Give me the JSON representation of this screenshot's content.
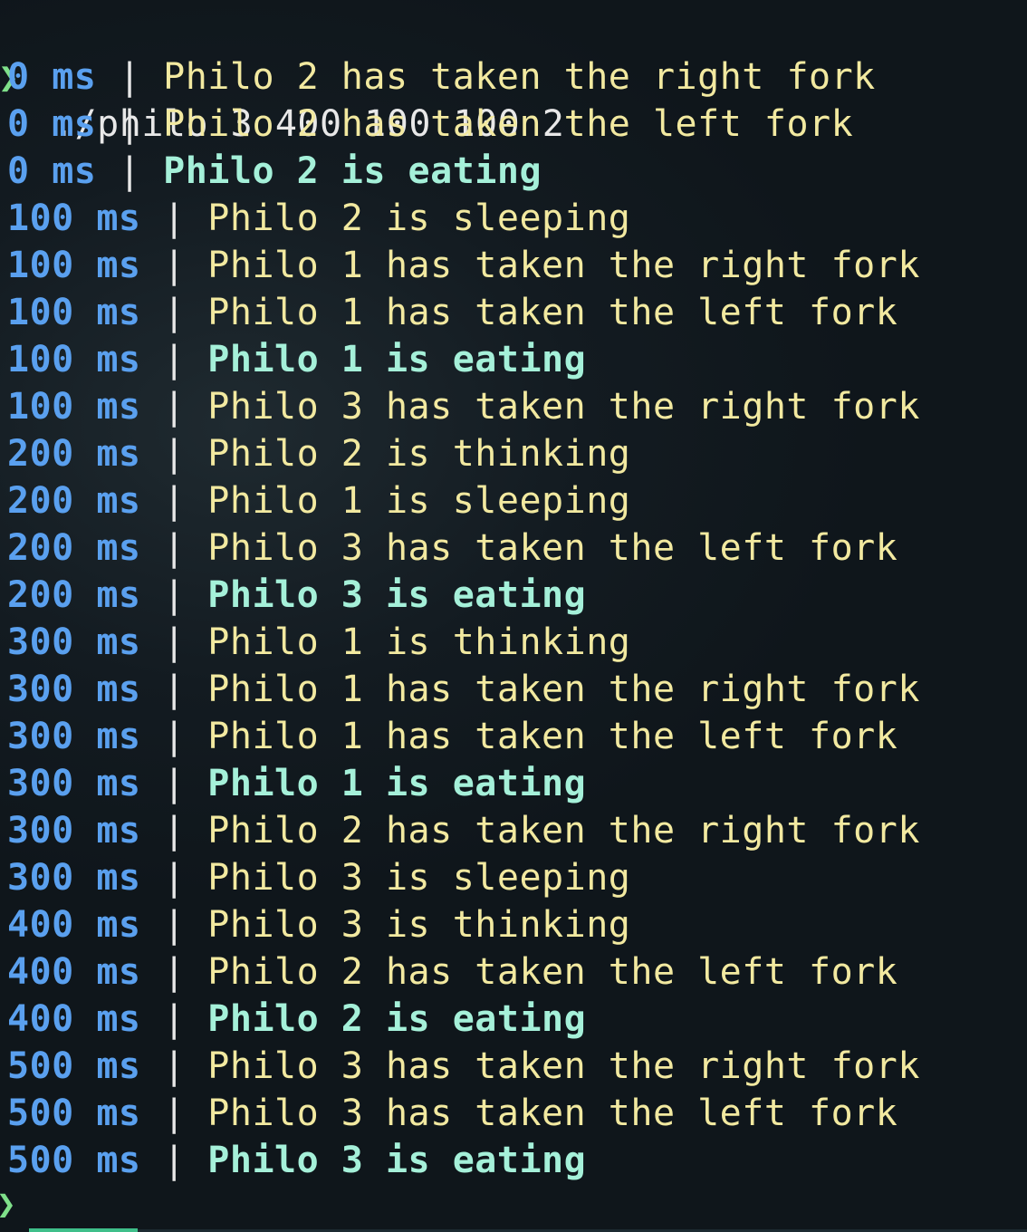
{
  "prompt": {
    "symbol": "❯",
    "command": "./philo 3 400 100 100 2"
  },
  "log": [
    {
      "time": "0",
      "unit": "ms",
      "sep": "|",
      "message": "Philo 2 has taken the right fork",
      "eating": false
    },
    {
      "time": "0",
      "unit": "ms",
      "sep": "|",
      "message": "Philo 2 has taken the left fork",
      "eating": false
    },
    {
      "time": "0",
      "unit": "ms",
      "sep": "|",
      "message": "Philo 2 is eating",
      "eating": true
    },
    {
      "time": "100",
      "unit": "ms",
      "sep": "|",
      "message": "Philo 2 is sleeping",
      "eating": false
    },
    {
      "time": "100",
      "unit": "ms",
      "sep": "|",
      "message": "Philo 1 has taken the right fork",
      "eating": false
    },
    {
      "time": "100",
      "unit": "ms",
      "sep": "|",
      "message": "Philo 1 has taken the left fork",
      "eating": false
    },
    {
      "time": "100",
      "unit": "ms",
      "sep": "|",
      "message": "Philo 1 is eating",
      "eating": true
    },
    {
      "time": "100",
      "unit": "ms",
      "sep": "|",
      "message": "Philo 3 has taken the right fork",
      "eating": false
    },
    {
      "time": "200",
      "unit": "ms",
      "sep": "|",
      "message": "Philo 2 is thinking",
      "eating": false
    },
    {
      "time": "200",
      "unit": "ms",
      "sep": "|",
      "message": "Philo 1 is sleeping",
      "eating": false
    },
    {
      "time": "200",
      "unit": "ms",
      "sep": "|",
      "message": "Philo 3 has taken the left fork",
      "eating": false
    },
    {
      "time": "200",
      "unit": "ms",
      "sep": "|",
      "message": "Philo 3 is eating",
      "eating": true
    },
    {
      "time": "300",
      "unit": "ms",
      "sep": "|",
      "message": "Philo 1 is thinking",
      "eating": false
    },
    {
      "time": "300",
      "unit": "ms",
      "sep": "|",
      "message": "Philo 1 has taken the right fork",
      "eating": false
    },
    {
      "time": "300",
      "unit": "ms",
      "sep": "|",
      "message": "Philo 1 has taken the left fork",
      "eating": false
    },
    {
      "time": "300",
      "unit": "ms",
      "sep": "|",
      "message": "Philo 1 is eating",
      "eating": true
    },
    {
      "time": "300",
      "unit": "ms",
      "sep": "|",
      "message": "Philo 2 has taken the right fork",
      "eating": false
    },
    {
      "time": "300",
      "unit": "ms",
      "sep": "|",
      "message": "Philo 3 is sleeping",
      "eating": false
    },
    {
      "time": "400",
      "unit": "ms",
      "sep": "|",
      "message": "Philo 3 is thinking",
      "eating": false
    },
    {
      "time": "400",
      "unit": "ms",
      "sep": "|",
      "message": "Philo 2 has taken the left fork",
      "eating": false
    },
    {
      "time": "400",
      "unit": "ms",
      "sep": "|",
      "message": "Philo 2 is eating",
      "eating": true
    },
    {
      "time": "500",
      "unit": "ms",
      "sep": "|",
      "message": "Philo 3 has taken the right fork",
      "eating": false
    },
    {
      "time": "500",
      "unit": "ms",
      "sep": "|",
      "message": "Philo 3 has taken the left fork",
      "eating": false
    },
    {
      "time": "500",
      "unit": "ms",
      "sep": "|",
      "message": "Philo 3 is eating",
      "eating": true
    }
  ],
  "next_prompt": {
    "symbol": "❯"
  },
  "colors": {
    "prompt": "#7fe08a",
    "timestamp": "#5aa0ef",
    "message": "#f2e9a0",
    "eating": "#a5f0d9",
    "background": "#131b21"
  }
}
